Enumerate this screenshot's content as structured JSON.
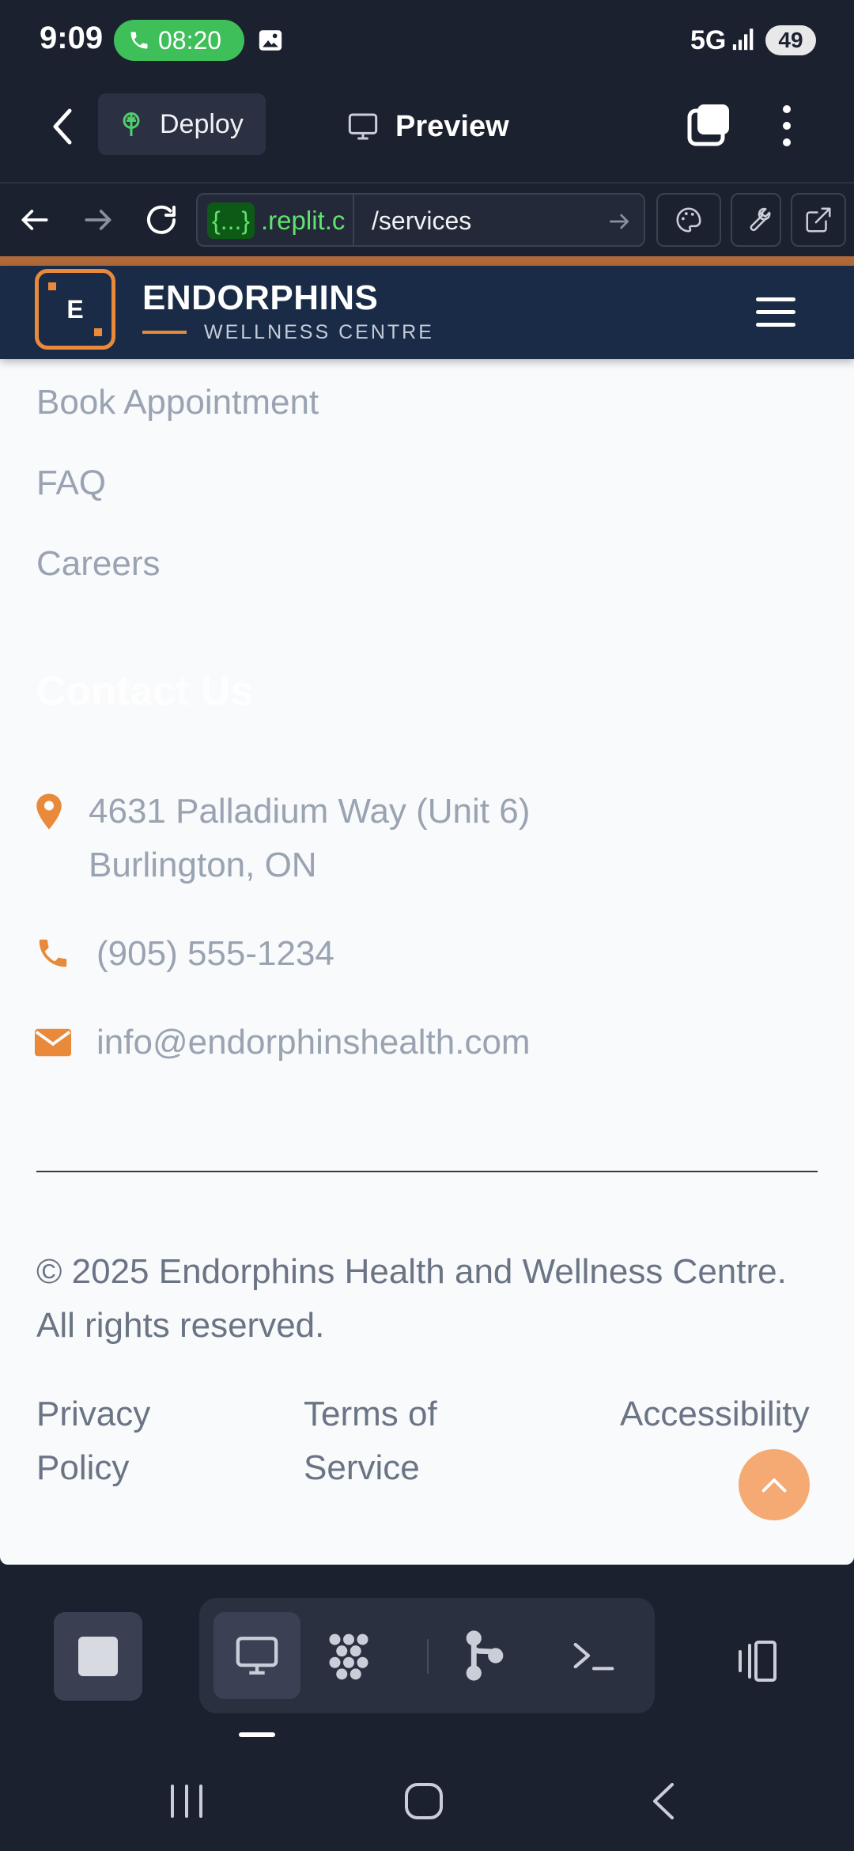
{
  "status_bar": {
    "time": "9:09",
    "call_timer": "08:20",
    "network": "5G",
    "battery": "49"
  },
  "header": {
    "deploy_label": "Deploy",
    "preview_label": "Preview"
  },
  "url_bar": {
    "badge": "{...}",
    "domain": ".replit.c",
    "path": "/services"
  },
  "site": {
    "brand_letter": "E",
    "brand_name": "ENDORPHINS",
    "brand_sub": "WELLNESS CENTRE",
    "links": [
      "Book Appointment",
      "FAQ",
      "Careers"
    ],
    "contact_title": "Contact Us",
    "address_line1": "4631 Palladium Way (Unit 6)",
    "address_line2": "Burlington, ON",
    "phone": "(905) 555-1234",
    "email": "info@endorphinshealth.com",
    "copyright": "© 2025 Endorphins Health and Wellness Centre. All rights reserved.",
    "legal": {
      "privacy_1": "Privacy",
      "privacy_2": "Policy",
      "terms_1": "Terms of",
      "terms_2": "Service",
      "accessibility": "Accessibility"
    }
  },
  "colors": {
    "accent": "#e88a3a",
    "nav_bg": "#1a2b47",
    "app_bg": "#1c2130",
    "url_green": "#5fe36c"
  }
}
